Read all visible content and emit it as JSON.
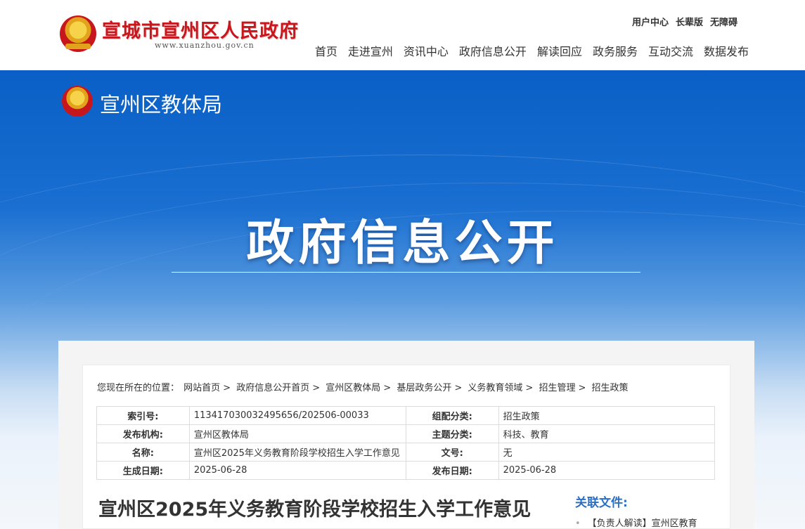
{
  "header": {
    "site_name": "宣城市宣州区人民政府",
    "site_url": "www.xuanzhou.gov.cn",
    "util_links": [
      "用户中心",
      "长辈版",
      "无障碍"
    ],
    "nav": [
      "首页",
      "走进宣州",
      "资讯中心",
      "政府信息公开",
      "解读回应",
      "政务服务",
      "互动交流",
      "数据发布"
    ]
  },
  "banner": {
    "dept_name": "宣州区教体局",
    "title": "政府信息公开"
  },
  "breadcrumb": {
    "prefix": "您现在所在的位置：",
    "items": [
      "网站首页",
      "政府信息公开首页",
      "宣州区教体局",
      "基层政务公开",
      "义务教育领域",
      "招生管理",
      "招生政策"
    ]
  },
  "meta": {
    "rows": [
      {
        "k1": "索引号:",
        "v1": "113417030032495656/202506-00033",
        "k2": "组配分类:",
        "v2": "招生政策"
      },
      {
        "k1": "发布机构:",
        "v1": "宣州区教体局",
        "k2": "主题分类:",
        "v2": "科技、教育"
      },
      {
        "k1": "名称:",
        "v1": "宣州区2025年义务教育阶段学校招生入学工作意见",
        "k2": "文号:",
        "v2": "无"
      },
      {
        "k1": "生成日期:",
        "v1": "2025-06-28",
        "k2": "发布日期:",
        "v2": "2025-06-28"
      }
    ]
  },
  "document": {
    "title": "宣州区2025年义务教育阶段学校招生入学工作意见"
  },
  "related": {
    "title": "关联文件:",
    "items": [
      "【负责人解读】宣州区教育"
    ]
  },
  "colors": {
    "brand_red": "#c8161d",
    "banner_blue": "#0a5fc6",
    "related_blue": "#2a6fc1"
  },
  "icons": {
    "emblem": "national-emblem-icon"
  }
}
